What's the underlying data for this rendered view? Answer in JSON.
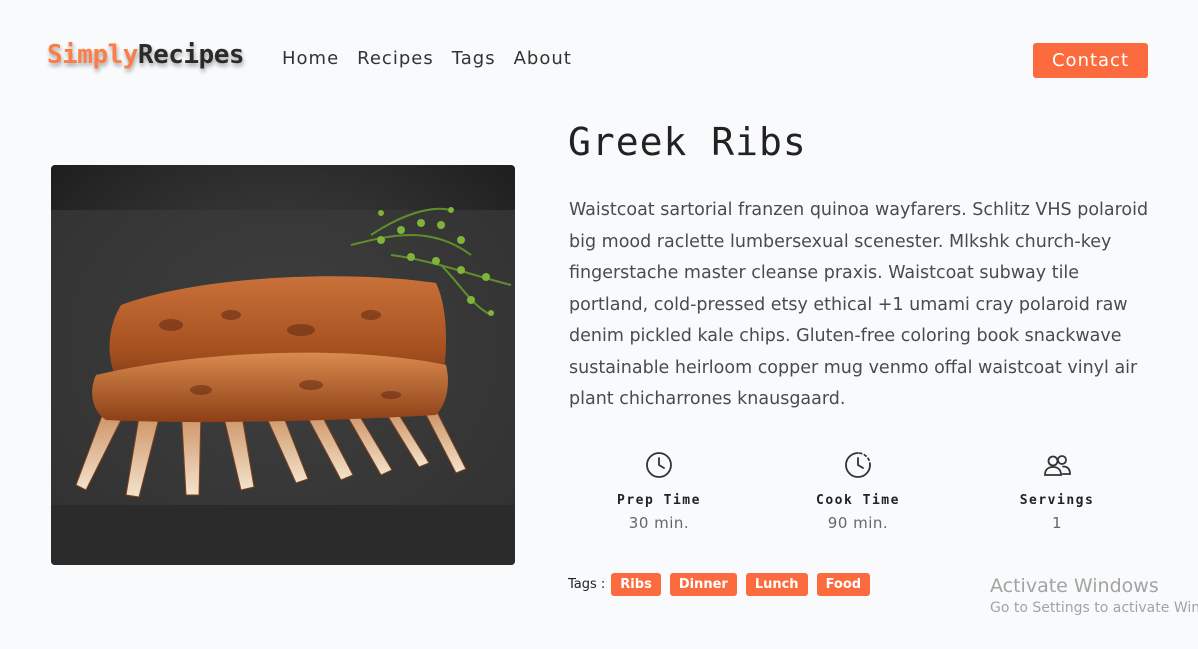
{
  "brand": {
    "part1": "Simply",
    "part2": "Recipes"
  },
  "nav": {
    "items": [
      "Home",
      "Recipes",
      "Tags",
      "About"
    ],
    "contact": "Contact"
  },
  "recipe": {
    "title": "Greek Ribs",
    "description": "Waistcoat sartorial franzen quinoa wayfarers. Schlitz VHS polaroid big mood raclette lumbersexual scenester. Mlkshk church-key fingerstache master cleanse praxis. Waistcoat subway tile portland, cold-pressed etsy ethical +1 umami cray polaroid raw denim pickled kale chips. Gluten-free coloring book snackwave sustainable heirloom copper mug venmo offal waistcoat vinyl air plant chicharrones knausgaard.",
    "stats": [
      {
        "icon": "clock-icon",
        "label": "Prep Time",
        "value": "30 min."
      },
      {
        "icon": "clock-dashed-icon",
        "label": "Cook Time",
        "value": "90 min."
      },
      {
        "icon": "users-icon",
        "label": "Servings",
        "value": "1"
      }
    ],
    "tags_label": "Tags :",
    "tags": [
      "Ribs",
      "Dinner",
      "Lunch",
      "Food"
    ]
  },
  "watermark": {
    "line1": "Activate Windows",
    "line2": "Go to Settings to activate Windows."
  },
  "colors": {
    "accent": "#fb6b3e",
    "background": "#f8fafc"
  }
}
